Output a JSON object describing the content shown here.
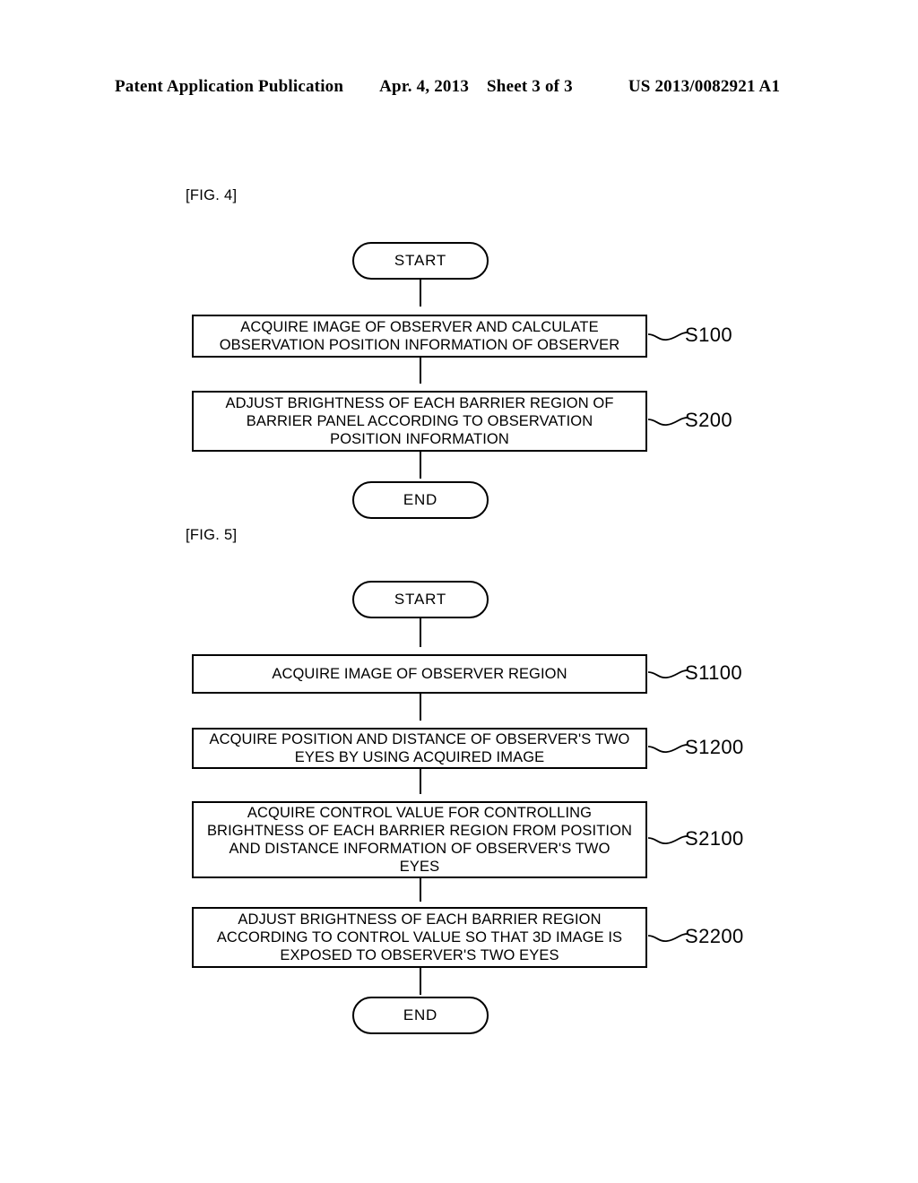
{
  "header": {
    "publication": "Patent Application Publication",
    "date": "Apr. 4, 2013",
    "sheet": "Sheet 3 of 3",
    "patent_number": "US 2013/0082921 A1"
  },
  "figures": [
    {
      "label": "[FIG. 4]",
      "nodes": {
        "start": "START",
        "end": "END",
        "steps": [
          {
            "text": "ACQUIRE IMAGE OF OBSERVER AND CALCULATE\nOBSERVATION POSITION INFORMATION OF OBSERVER",
            "step_number": "S100"
          },
          {
            "text": "ADJUST BRIGHTNESS OF EACH BARRIER REGION OF\nBARRIER PANEL ACCORDING TO OBSERVATION\nPOSITION INFORMATION",
            "step_number": "S200"
          }
        ]
      }
    },
    {
      "label": "[FIG. 5]",
      "nodes": {
        "start": "START",
        "end": "END",
        "steps": [
          {
            "text": "ACQUIRE IMAGE OF OBSERVER REGION",
            "step_number": "S1100"
          },
          {
            "text": "ACQUIRE POSITION AND DISTANCE OF OBSERVER'S TWO\nEYES BY USING ACQUIRED IMAGE",
            "step_number": "S1200"
          },
          {
            "text": "ACQUIRE CONTROL VALUE FOR CONTROLLING\nBRIGHTNESS OF EACH BARRIER REGION FROM POSITION\nAND DISTANCE INFORMATION OF OBSERVER'S TWO\nEYES",
            "step_number": "S2100"
          },
          {
            "text": "ADJUST BRIGHTNESS OF EACH BARRIER REGION\nACCORDING TO CONTROL VALUE SO THAT 3D IMAGE IS\nEXPOSED TO OBSERVER'S TWO EYES",
            "step_number": "S2200"
          }
        ]
      }
    }
  ],
  "colors": {
    "ink": "#000000",
    "page": "#ffffff"
  }
}
